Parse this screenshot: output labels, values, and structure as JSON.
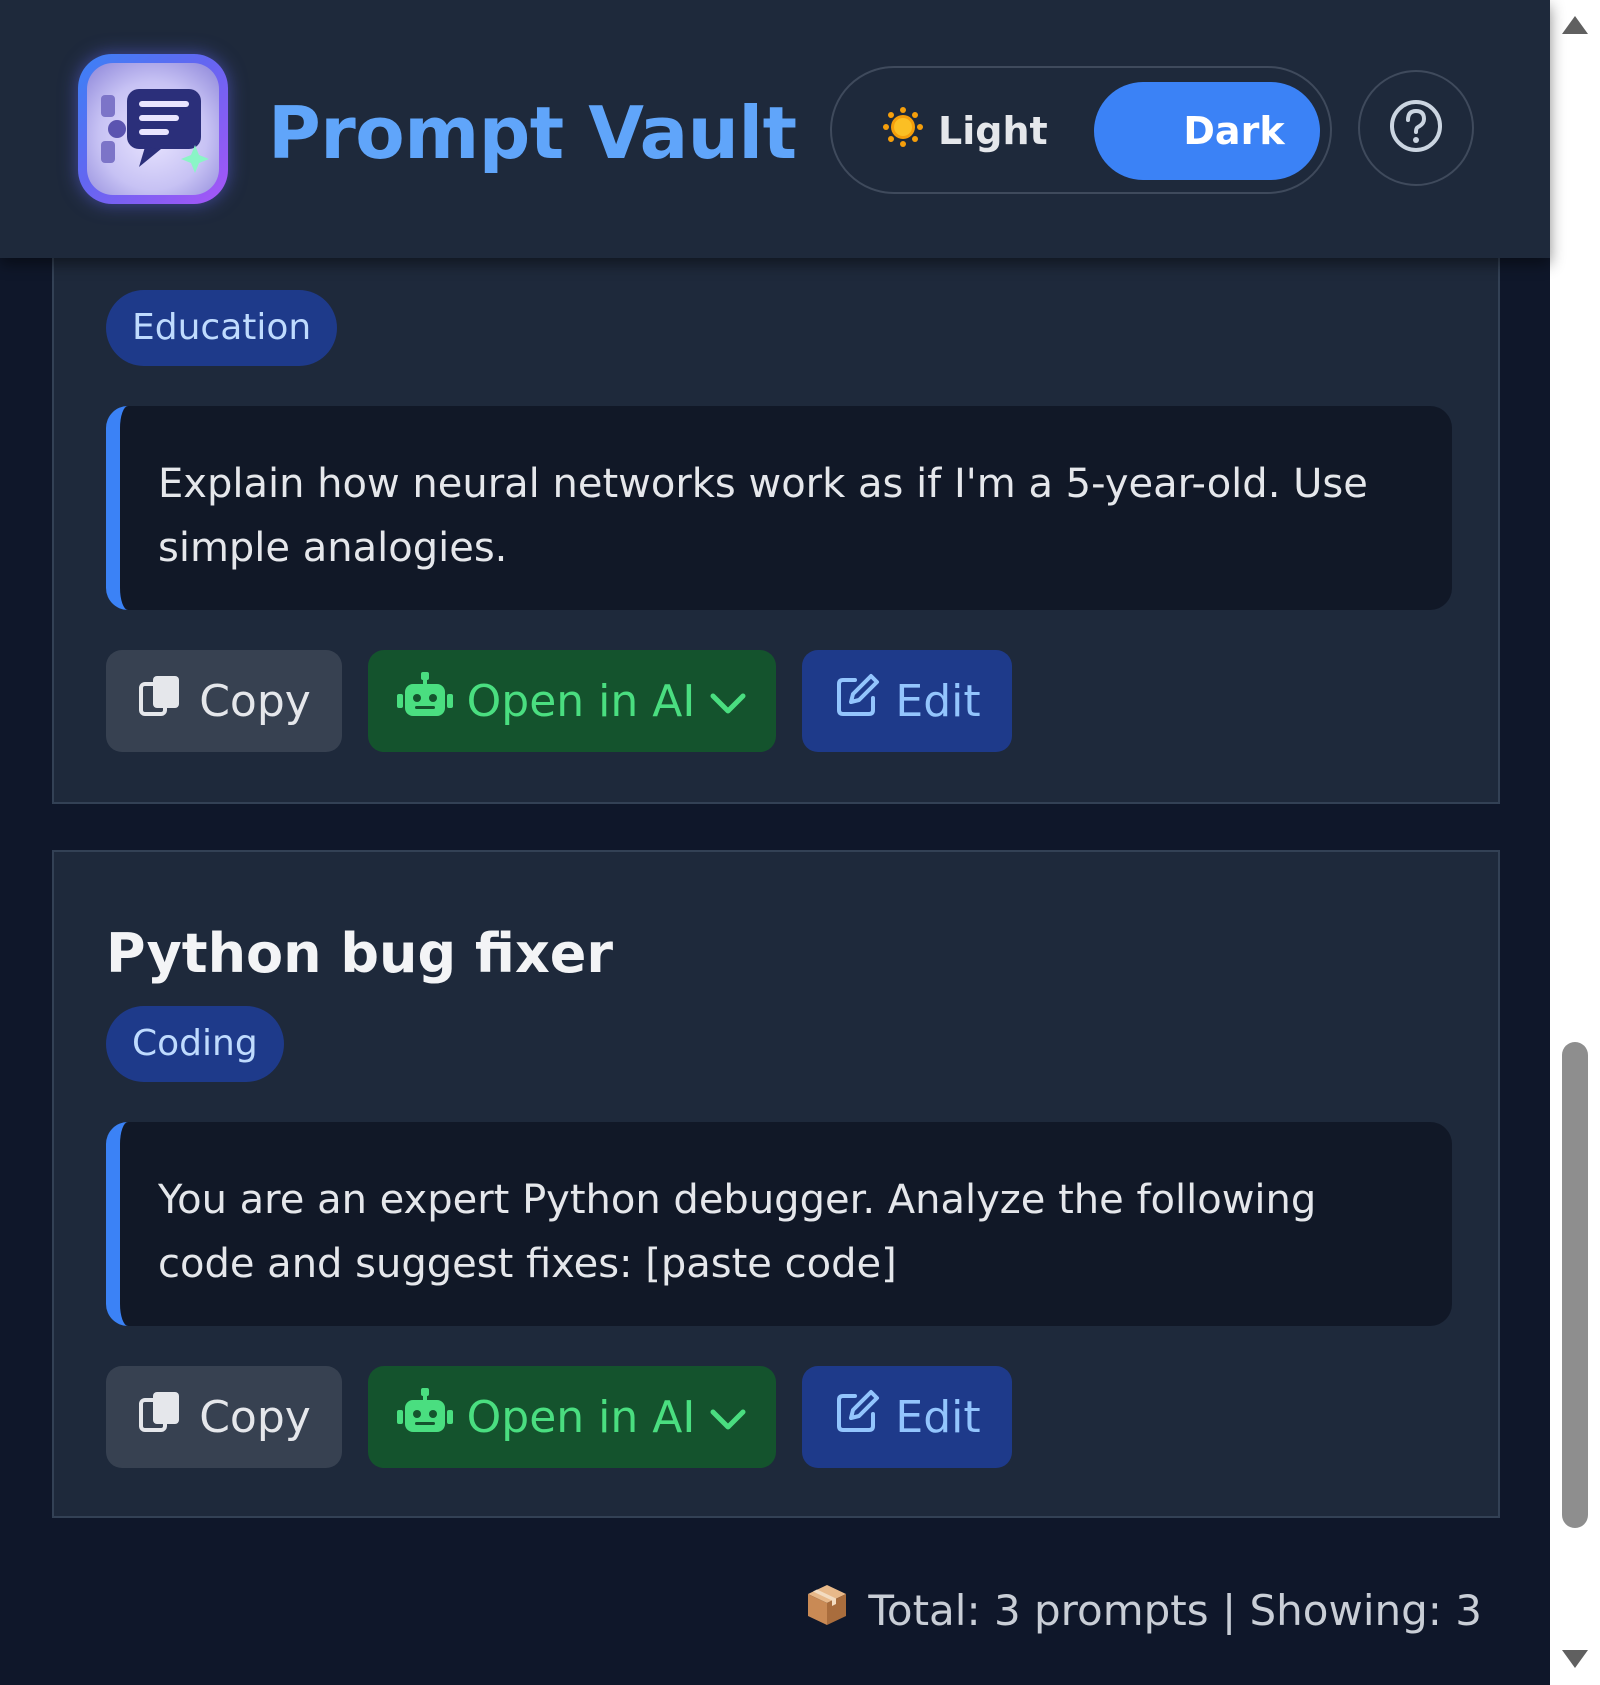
{
  "header": {
    "title": "Prompt Vault",
    "theme": {
      "light_label": "Light",
      "dark_label": "Dark",
      "active": "Dark"
    }
  },
  "cards": [
    {
      "title": "",
      "category": "Education",
      "prompt": "Explain how neural networks work as if I'm a 5-year-old. Use simple analogies.",
      "actions": {
        "copy": "Copy",
        "open": "Open in AI",
        "edit": "Edit"
      }
    },
    {
      "title": "Python bug fixer",
      "category": "Coding",
      "prompt": "You are an expert Python debugger. Analyze the following code and suggest fixes: [paste code]",
      "actions": {
        "copy": "Copy",
        "open": "Open in AI",
        "edit": "Edit"
      }
    }
  ],
  "footer": {
    "status": "Total: 3 prompts | Showing: 3"
  },
  "colors": {
    "background": "#0f172a",
    "card": "#1e293b",
    "accent": "#3b82f6",
    "title": "#60a5fa",
    "open_button": "#14532d",
    "edit_button": "#1e3a8a"
  },
  "icons": [
    "vault-chat-logo-icon",
    "sun-icon",
    "moon-icon",
    "help-icon",
    "copy-icon",
    "robot-icon",
    "chevron-down-icon",
    "edit-icon",
    "package-icon"
  ]
}
